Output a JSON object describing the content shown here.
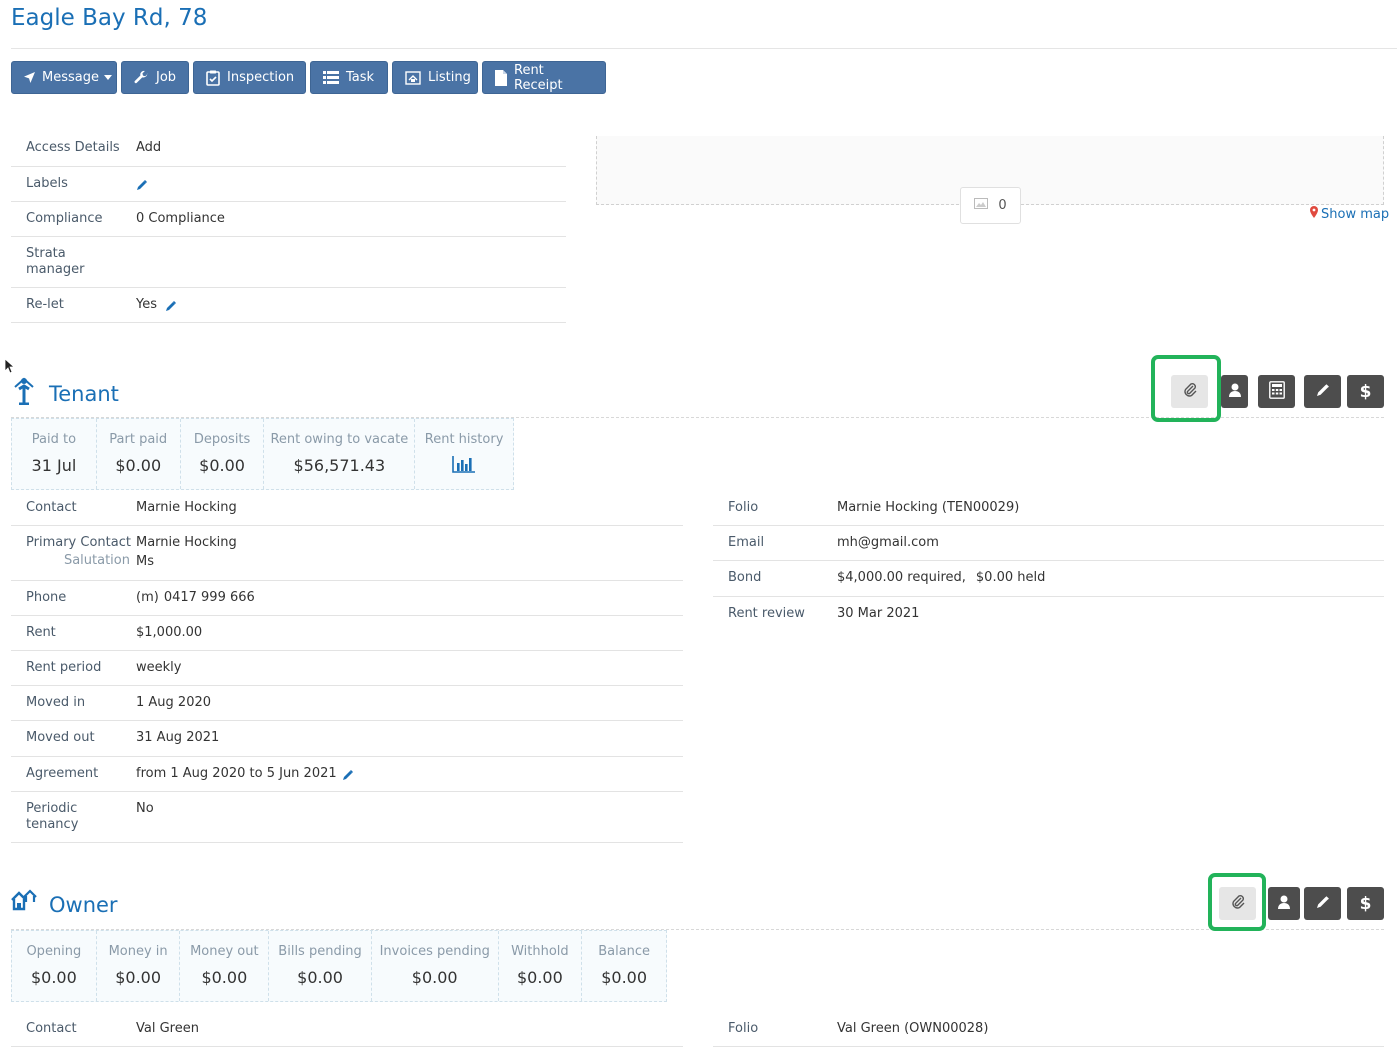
{
  "page": {
    "title": "Eagle Bay Rd, 78"
  },
  "toolbar": {
    "message": "Message",
    "job": "Job",
    "inspection": "Inspection",
    "task": "Task",
    "listing": "Listing",
    "rent_receipt": "Rent Receipt"
  },
  "property": {
    "access_details_label": "Access Details",
    "access_details_value": "Add",
    "labels_label": "Labels",
    "compliance_label": "Compliance",
    "compliance_value": "0 Compliance",
    "strata_label_1": "Strata",
    "strata_label_2": "manager",
    "relet_label": "Re-let",
    "relet_value": "Yes"
  },
  "media": {
    "photo_count": "0",
    "show_map": "Show map"
  },
  "tenant": {
    "title": "Tenant",
    "stats": [
      {
        "label": "Paid to",
        "value": "31 Jul"
      },
      {
        "label": "Part paid",
        "value": "$0.00"
      },
      {
        "label": "Deposits",
        "value": "$0.00"
      },
      {
        "label": "Rent owing to vacate",
        "value": "$56,571.43"
      },
      {
        "label": "Rent history",
        "value": ""
      }
    ],
    "contact_label": "Contact",
    "contact_value": "Marnie Hocking",
    "primary_contact_label": "Primary Contact",
    "primary_contact_value": "Marnie Hocking",
    "salutation_label": "Salutation",
    "salutation_value": "Ms",
    "phone_label": "Phone",
    "phone_prefix": "(m)",
    "phone_value": "0417 999 666",
    "rent_label": "Rent",
    "rent_value": "$1,000.00",
    "rent_period_label": "Rent period",
    "rent_period_value": "weekly",
    "moved_in_label": "Moved in",
    "moved_in_value": "1 Aug 2020",
    "moved_out_label": "Moved out",
    "moved_out_value": "31 Aug 2021",
    "agreement_label": "Agreement",
    "agreement_value": "from 1 Aug 2020 to 5 Jun 2021",
    "periodic_label_1": "Periodic",
    "periodic_label_2": "tenancy",
    "periodic_value": "No",
    "folio_label": "Folio",
    "folio_value": "Marnie Hocking (TEN00029)",
    "email_label": "Email",
    "email_value": "mh@gmail.com",
    "bond_label": "Bond",
    "bond_required": "$4,000.00 required,",
    "bond_held": "$0.00 held",
    "rent_review_label": "Rent review",
    "rent_review_value": "30 Mar 2021"
  },
  "owner": {
    "title": "Owner",
    "stats": [
      {
        "label": "Opening",
        "value": "$0.00"
      },
      {
        "label": "Money in",
        "value": "$0.00"
      },
      {
        "label": "Money out",
        "value": "$0.00"
      },
      {
        "label": "Bills pending",
        "value": "$0.00"
      },
      {
        "label": "Invoices pending",
        "value": "$0.00"
      },
      {
        "label": "Withhold",
        "value": "$0.00"
      },
      {
        "label": "Balance",
        "value": "$0.00"
      }
    ],
    "contact_label": "Contact",
    "contact_value": "Val Green",
    "folio_label": "Folio",
    "folio_value": "Val Green (OWN00028)"
  },
  "colors": {
    "accent": "#1a6fb5",
    "toolbar": "#4a73a5",
    "highlight": "#22b35a",
    "dark_button": "#4d4d4d"
  }
}
